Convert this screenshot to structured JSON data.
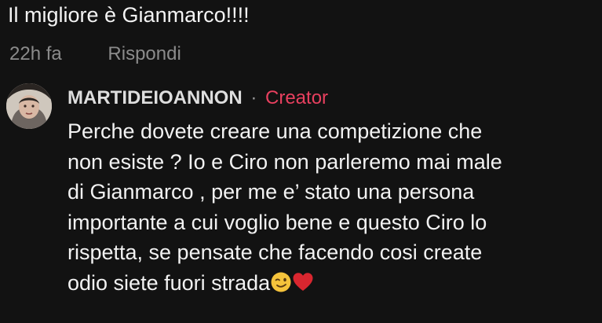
{
  "top_comment": {
    "text": "Il migliore è Gianmarco!!!!",
    "time": "22h fa",
    "reply_label": "Rispondi"
  },
  "reply": {
    "author": "MARTIDEIOANNON",
    "separator": "·",
    "badge": "Creator",
    "lines": [
      "Perche dovete creare una competizione che",
      "non esiste ? Io e Ciro non parleremo mai male",
      "di Gianmarco , per me e’ stato una persona",
      "importante a cui voglio bene e questo Ciro lo",
      "rispetta, se pensate che facendo cosi create",
      "odio siete fuori strada"
    ],
    "emojis": [
      "wink-face-emoji",
      "red-heart-emoji"
    ]
  },
  "colors": {
    "background": "#121212",
    "text": "#f2f2f2",
    "meta": "#8b8b8b",
    "creator": "#e8405f"
  }
}
